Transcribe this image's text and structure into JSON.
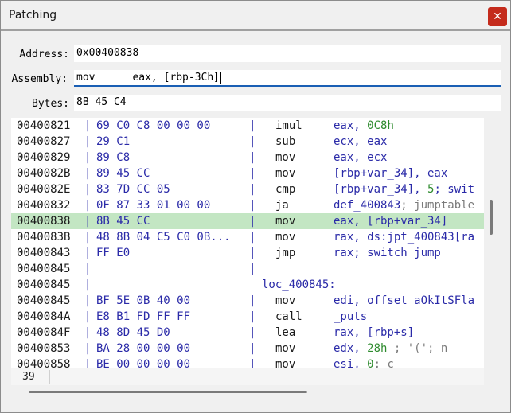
{
  "window": {
    "title": "Patching",
    "close_glyph": "✕"
  },
  "fields": {
    "address": {
      "label": "Address:",
      "value": "0x00400838"
    },
    "assembly": {
      "label": "Assembly:",
      "value": "mov      eax, [rbp-3Ch]"
    },
    "bytes": {
      "label": "Bytes:",
      "value": "8B 45 C4"
    }
  },
  "listing": {
    "separator": "|",
    "rows": [
      {
        "addr": "00400821",
        "bytes": "69 C0 C8 00 00 00",
        "mnem": "imul",
        "ops": "eax, ",
        "num": "0C8h",
        "comment": ""
      },
      {
        "addr": "00400827",
        "bytes": "29 C1",
        "mnem": "sub",
        "ops": "ecx, eax",
        "num": "",
        "comment": ""
      },
      {
        "addr": "00400829",
        "bytes": "89 C8",
        "mnem": "mov",
        "ops": "eax, ecx",
        "num": "",
        "comment": ""
      },
      {
        "addr": "0040082B",
        "bytes": "89 45 CC",
        "mnem": "mov",
        "ops": "[rbp+var_34], eax",
        "num": "",
        "comment": ""
      },
      {
        "addr": "0040082E",
        "bytes": "83 7D CC 05",
        "mnem": "cmp",
        "ops": "[rbp+var_34], ",
        "num": "5",
        "ops2": "; swit",
        "comment": ""
      },
      {
        "addr": "00400832",
        "bytes": "0F 87 33 01 00 00",
        "mnem": "ja",
        "ops": "def_400843",
        "num": "",
        "comment": "; jumptable"
      },
      {
        "addr": "00400838",
        "bytes": "8B 45 CC",
        "mnem": "mov",
        "ops": "eax, [rbp+var_34]",
        "num": "",
        "comment": "",
        "selected": true
      },
      {
        "addr": "0040083B",
        "bytes": "48 8B 04 C5 C0 0B...",
        "mnem": "mov",
        "ops": "rax, ds:jpt_400843[ra",
        "num": "",
        "comment": ""
      },
      {
        "addr": "00400843",
        "bytes": "FF E0",
        "mnem": "jmp",
        "ops": "rax; switch jump",
        "num": "",
        "comment": ""
      },
      {
        "addr": "00400845",
        "bytes": "",
        "mnem": "",
        "ops": "",
        "num": "",
        "comment": ""
      },
      {
        "addr": "00400845",
        "bytes": "",
        "label": "loc_400845:",
        "mnem": "",
        "ops": "",
        "num": "",
        "comment": ""
      },
      {
        "addr": "00400845",
        "bytes": "BF 5E 0B 40 00",
        "mnem": "mov",
        "ops": "edi, offset aOkItSFla",
        "num": "",
        "comment": ""
      },
      {
        "addr": "0040084A",
        "bytes": "E8 B1 FD FF FF",
        "mnem": "call",
        "ops": "_puts",
        "num": "",
        "comment": ""
      },
      {
        "addr": "0040084F",
        "bytes": "48 8D 45 D0",
        "mnem": "lea",
        "ops": "rax, [rbp+s]",
        "num": "",
        "comment": ""
      },
      {
        "addr": "00400853",
        "bytes": "BA 28 00 00 00",
        "mnem": "mov",
        "ops": "edx, ",
        "num": "28h",
        "comment": " ; '('; n"
      },
      {
        "addr": "00400858",
        "bytes": "BE 00 00 00 00",
        "mnem": "mov",
        "ops": "esi, ",
        "num": "0",
        "comment": "; c"
      }
    ]
  },
  "status": {
    "value": "39"
  }
}
